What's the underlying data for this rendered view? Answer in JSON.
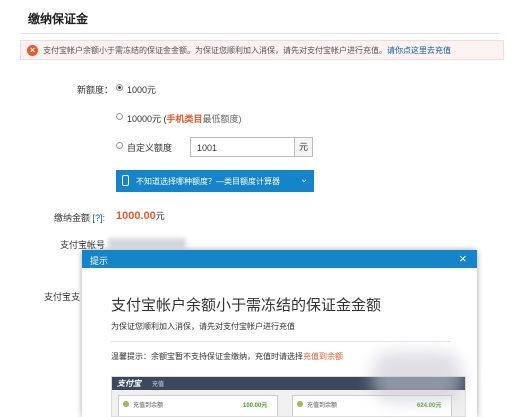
{
  "page": {
    "title": "缴纳保证金"
  },
  "alert": {
    "icon": "error-icon",
    "message": "支付宝帐户余额小于需冻结的保证金金额。为保证您顺利加入消保，请先对支付宝帐户进行充值。",
    "link": "请你点这里去充值"
  },
  "form": {
    "quota_label": "新额度：",
    "options": [
      {
        "label": "1000元",
        "selected": true
      },
      {
        "label_pre": "10000元 (",
        "highlight": "手机类目",
        "label_post": "最低额度)",
        "selected": false
      },
      {
        "label": "自定义额度",
        "selected": false
      }
    ],
    "custom_value": "1001",
    "unit": "元",
    "calculator_text": "不知道选择哪种额度？—类目额度计算器",
    "amount_label": "缴纳金额",
    "amount_help": "[?]:",
    "amount_value": "1000.00",
    "amount_unit": "元",
    "account_label": "支付宝帐号",
    "pay_label": "支付宝支"
  },
  "modal": {
    "title": "提示",
    "close": "×",
    "heading": "支付宝帐户余额小于需冻结的保证金金额",
    "subtext": "为保证您顺利加入消保，请先对支付宝帐户进行充值",
    "tip_pre": "温馨提示：余额宝暂不支持保证金缴纳，充值时请选择",
    "tip_red": "充值到余额",
    "shot": {
      "logo": "支付宝",
      "tab": "充值",
      "card1_label": "充值到余额",
      "card1_amount": "100.00元",
      "card2_label": "充值到余额",
      "card2_amount": "624.00元"
    }
  },
  "colors": {
    "primary": "#1684c9",
    "accent": "#e85a2c",
    "link": "#0c5da8"
  }
}
